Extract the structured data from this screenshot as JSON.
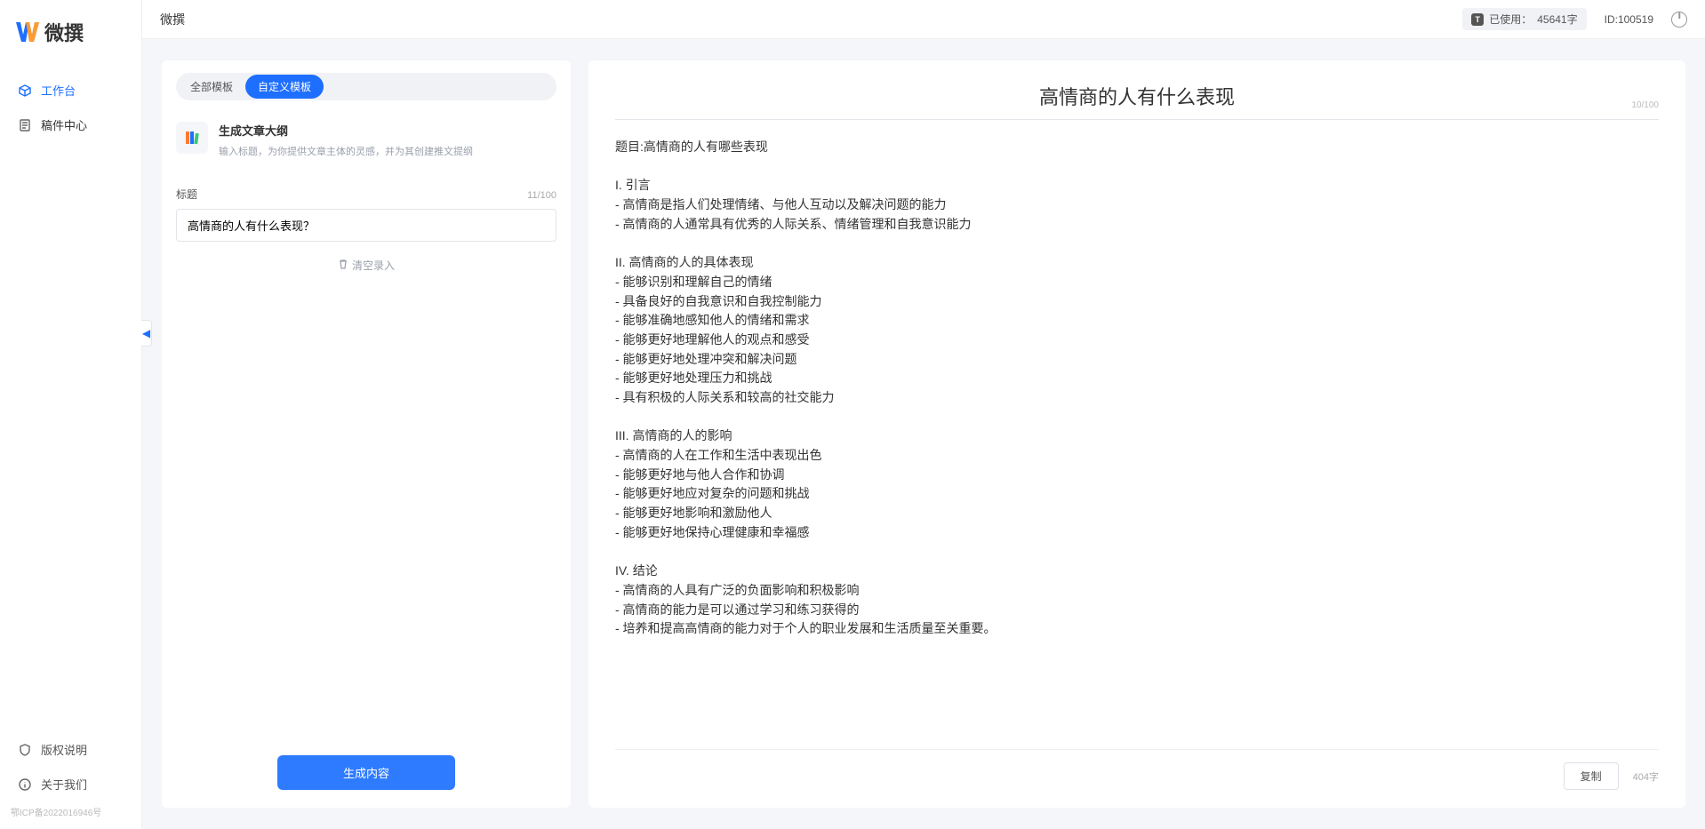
{
  "brand": "微撰",
  "sidebar": {
    "items": [
      {
        "label": "工作台",
        "icon": "cube-icon",
        "active": true
      },
      {
        "label": "稿件中心",
        "icon": "doc-icon",
        "active": false
      }
    ],
    "bottom": [
      {
        "label": "版权说明",
        "icon": "shield-icon"
      },
      {
        "label": "关于我们",
        "icon": "info-icon"
      }
    ],
    "icp": "鄂ICP备2022016946号"
  },
  "topbar": {
    "title": "微撰",
    "usage_prefix": "已使用：",
    "usage_value": "45641字",
    "user_id_label": "ID:100519"
  },
  "left": {
    "tabs": {
      "all": "全部模板",
      "custom": "自定义模板",
      "active": "custom"
    },
    "template": {
      "title": "生成文章大纲",
      "desc": "输入标题，为你提供文章主体的灵感，并为其创建推文提纲"
    },
    "field_label": "标题",
    "field_counter": "11/100",
    "field_value": "高情商的人有什么表现？",
    "clear_label": "清空录入",
    "generate_label": "生成内容"
  },
  "right": {
    "title": "高情商的人有什么表现",
    "title_counter": "10/100",
    "body": "题目:高情商的人有哪些表现\n\nI. 引言\n- 高情商是指人们处理情绪、与他人互动以及解决问题的能力\n- 高情商的人通常具有优秀的人际关系、情绪管理和自我意识能力\n\nII. 高情商的人的具体表现\n- 能够识别和理解自己的情绪\n- 具备良好的自我意识和自我控制能力\n- 能够准确地感知他人的情绪和需求\n- 能够更好地理解他人的观点和感受\n- 能够更好地处理冲突和解决问题\n- 能够更好地处理压力和挑战\n- 具有积极的人际关系和较高的社交能力\n\nIII. 高情商的人的影响\n- 高情商的人在工作和生活中表现出色\n- 能够更好地与他人合作和协调\n- 能够更好地应对复杂的问题和挑战\n- 能够更好地影响和激励他人\n- 能够更好地保持心理健康和幸福感\n\nIV. 结论\n- 高情商的人具有广泛的负面影响和积极影响\n- 高情商的能力是可以通过学习和练习获得的\n- 培养和提高高情商的能力对于个人的职业发展和生活质量至关重要。",
    "copy_label": "复制",
    "word_count": "404字"
  }
}
